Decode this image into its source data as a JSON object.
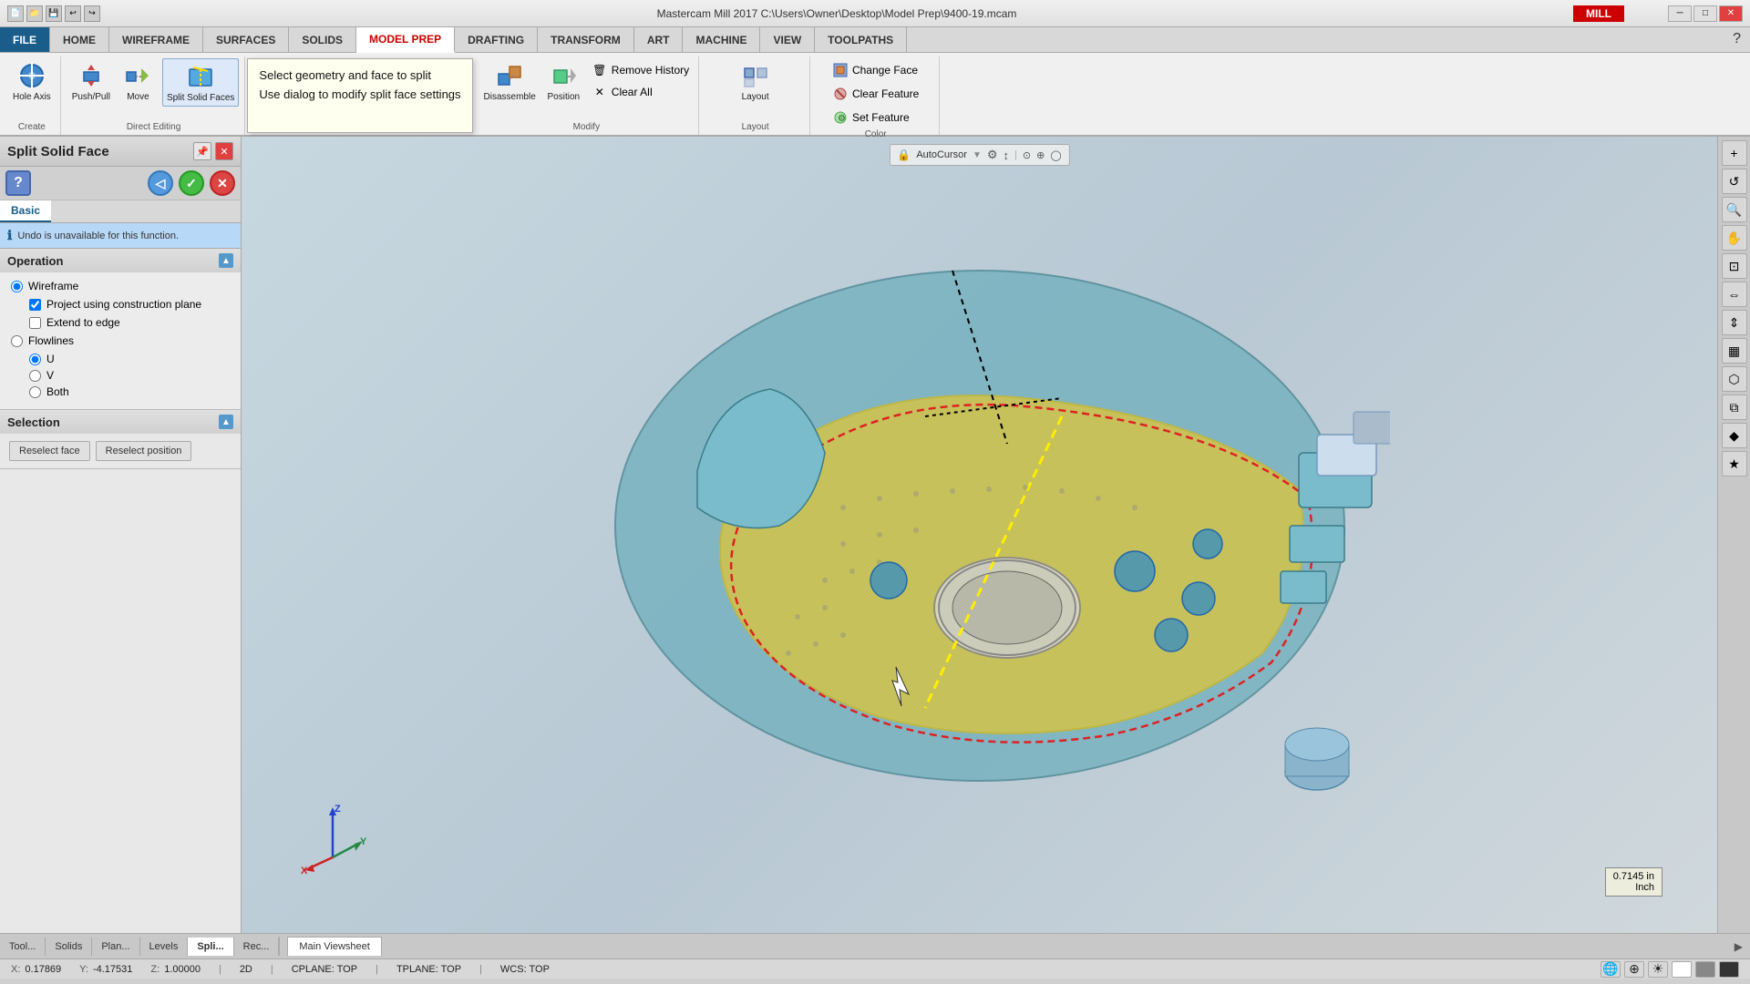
{
  "titlebar": {
    "title": "Mastercam Mill 2017  C:\\Users\\Owner\\Desktop\\Model Prep\\9400-19.mcam",
    "app_name": "MILL",
    "minimize_label": "─",
    "maximize_label": "□",
    "close_label": "✕"
  },
  "ribbon": {
    "tabs": [
      {
        "id": "file",
        "label": "FILE",
        "active": false
      },
      {
        "id": "home",
        "label": "HOME",
        "active": false
      },
      {
        "id": "wireframe",
        "label": "WIREFRAME",
        "active": false
      },
      {
        "id": "surfaces",
        "label": "SURFACES",
        "active": false
      },
      {
        "id": "solids",
        "label": "SOLIDS",
        "active": false
      },
      {
        "id": "model_prep",
        "label": "MODEL PREP",
        "active": true
      },
      {
        "id": "drafting",
        "label": "DRAFTING",
        "active": false
      },
      {
        "id": "transform",
        "label": "TRANSFORM",
        "active": false
      },
      {
        "id": "art",
        "label": "ART",
        "active": false
      },
      {
        "id": "machine",
        "label": "MACHINE",
        "active": false
      },
      {
        "id": "view",
        "label": "VIEW",
        "active": false
      },
      {
        "id": "toolpaths",
        "label": "TOOLPATHS",
        "active": false
      }
    ],
    "groups": {
      "create": {
        "label": "Create",
        "buttons": [
          {
            "id": "hole_axis",
            "label": "Hole\nAxis",
            "icon": "⊕"
          }
        ]
      },
      "direct_editing": {
        "label": "Direct Editing",
        "buttons": [
          {
            "id": "push_pull",
            "label": "Push/Pull",
            "icon": "⇕"
          },
          {
            "id": "move",
            "label": "Move",
            "icon": "↔"
          },
          {
            "id": "split_solid_faces",
            "label": "Split Solid\nFaces",
            "icon": "◱"
          }
        ]
      },
      "tooltip": {
        "line1": "Select geometry and face to split",
        "line2": "Use dialog to modify split face settings"
      },
      "modify": {
        "label": "Modify",
        "buttons": [
          {
            "id": "disassemble",
            "label": "Disassemble",
            "icon": "⊞"
          },
          {
            "id": "position",
            "label": "Position",
            "icon": "⊡"
          },
          {
            "id": "remove_history",
            "label": "Remove History",
            "icon": "🗑"
          },
          {
            "id": "clear_all",
            "label": "Clear AlI",
            "icon": "✕"
          }
        ]
      },
      "layout": {
        "label": "Layout",
        "buttons": []
      },
      "color": {
        "label": "Color",
        "buttons": [
          {
            "id": "change_face",
            "label": "Change Face",
            "icon": "🎨"
          },
          {
            "id": "clear_feature",
            "label": "Clear Feature",
            "icon": "🧹"
          },
          {
            "id": "set_feature",
            "label": "Set Feature",
            "icon": "⚙"
          }
        ]
      }
    }
  },
  "left_panel": {
    "title": "Split Solid Face",
    "help_icon": "?",
    "back_btn": "◁",
    "ok_btn": "✓",
    "cancel_btn": "✕",
    "tab_basic": "Basic",
    "info_text": "Undo is unavailable for this function.",
    "sections": {
      "operation": {
        "title": "Operation",
        "options": {
          "wireframe": {
            "label": "Wireframe",
            "checked": true,
            "sub_options": [
              {
                "id": "project_using",
                "label": "Project using construction plane",
                "checked": true
              },
              {
                "id": "extend_to_edge",
                "label": "Extend to edge",
                "checked": false
              }
            ]
          },
          "flowlines": {
            "label": "Flowlines",
            "checked": false,
            "sub_options": [
              {
                "id": "u",
                "label": "U",
                "checked": true
              },
              {
                "id": "v",
                "label": "V",
                "checked": false
              },
              {
                "id": "both",
                "label": "Both",
                "checked": false
              }
            ]
          }
        }
      },
      "selection": {
        "title": "Selection",
        "btn_reselect_face": "Reselect face",
        "btn_reselect_position": "Reselect position"
      }
    }
  },
  "viewport": {
    "autocursor_label": "AutoCursor",
    "view_tab": "Main Viewsheet"
  },
  "bottom_tabs": [
    {
      "id": "tool",
      "label": "Tool...",
      "active": false
    },
    {
      "id": "solids",
      "label": "Solids",
      "active": false
    },
    {
      "id": "plan",
      "label": "Plan...",
      "active": false
    },
    {
      "id": "levels",
      "label": "Levels",
      "active": false
    },
    {
      "id": "split",
      "label": "Spli...",
      "active": true
    },
    {
      "id": "rec",
      "label": "Rec...",
      "active": false
    }
  ],
  "statusbar": {
    "x_label": "X:",
    "x_val": "0.17869",
    "y_label": "Y:",
    "y_val": "-4.17531",
    "z_label": "Z:",
    "z_val": "1.00000",
    "mode": "2D",
    "cplane": "CPLANE: TOP",
    "tplane": "TPLANE: TOP",
    "wcs": "WCS: TOP"
  },
  "right_toolbar": {
    "buttons": [
      "⊕",
      "⊖",
      "✚",
      "↺",
      "⊙",
      "⇔",
      "⇕",
      "▦",
      "⬡",
      "⧉",
      "⬟",
      "◈"
    ]
  }
}
